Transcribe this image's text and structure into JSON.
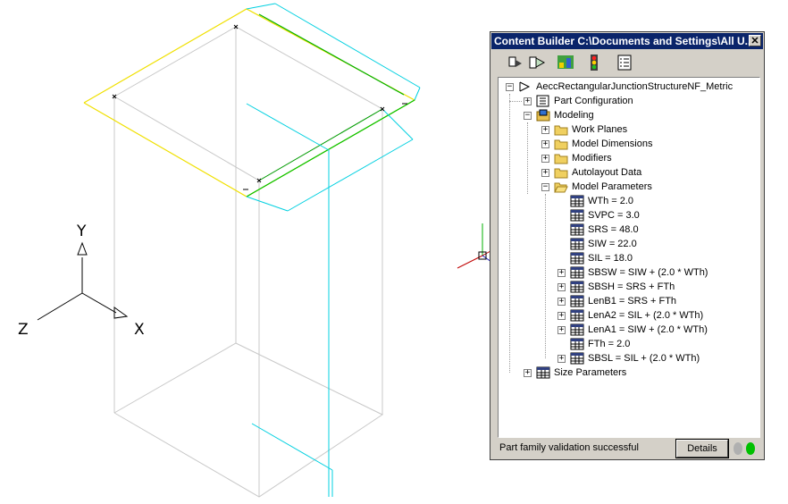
{
  "viewport": {
    "axis_labels": {
      "y": "Y",
      "x": "X",
      "z": "Z"
    }
  },
  "panel": {
    "title": "Content Builder C:\\Documents and Settings\\All U...",
    "close_glyph": "✕",
    "toolbar_icons": [
      "part-builder-icon",
      "export-icon",
      "validate-icon",
      "traffic-light-icon",
      "list-icon"
    ],
    "tree": {
      "root": "AeccRectangularJunctionStructureNF_Metric",
      "part_configuration": "Part Configuration",
      "modeling": "Modeling",
      "modeling_children": [
        "Work Planes",
        "Model Dimensions",
        "Modifiers",
        "Autolayout Data",
        "Model Parameters"
      ],
      "parameters": [
        {
          "label": "WTh = 2.0",
          "expandable": false
        },
        {
          "label": "SVPC = 3.0",
          "expandable": false
        },
        {
          "label": "SRS = 48.0",
          "expandable": false
        },
        {
          "label": "SIW = 22.0",
          "expandable": false
        },
        {
          "label": "SIL = 18.0",
          "expandable": false
        },
        {
          "label": "SBSW = SIW + (2.0 * WTh)",
          "expandable": true
        },
        {
          "label": "SBSH = SRS + FTh",
          "expandable": true
        },
        {
          "label": "LenB1 = SRS + FTh",
          "expandable": true
        },
        {
          "label": "LenA2 = SIL + (2.0 * WTh)",
          "expandable": true
        },
        {
          "label": "LenA1 = SIW + (2.0 * WTh)",
          "expandable": true
        },
        {
          "label": "FTh = 2.0",
          "expandable": false
        },
        {
          "label": "SBSL = SIL + (2.0 * WTh)",
          "expandable": true
        }
      ],
      "size_parameters": "Size Parameters"
    },
    "status": "Part family validation successful",
    "details_label": "Details",
    "status_lights": [
      "#b0b0b0",
      "#00c000"
    ]
  }
}
